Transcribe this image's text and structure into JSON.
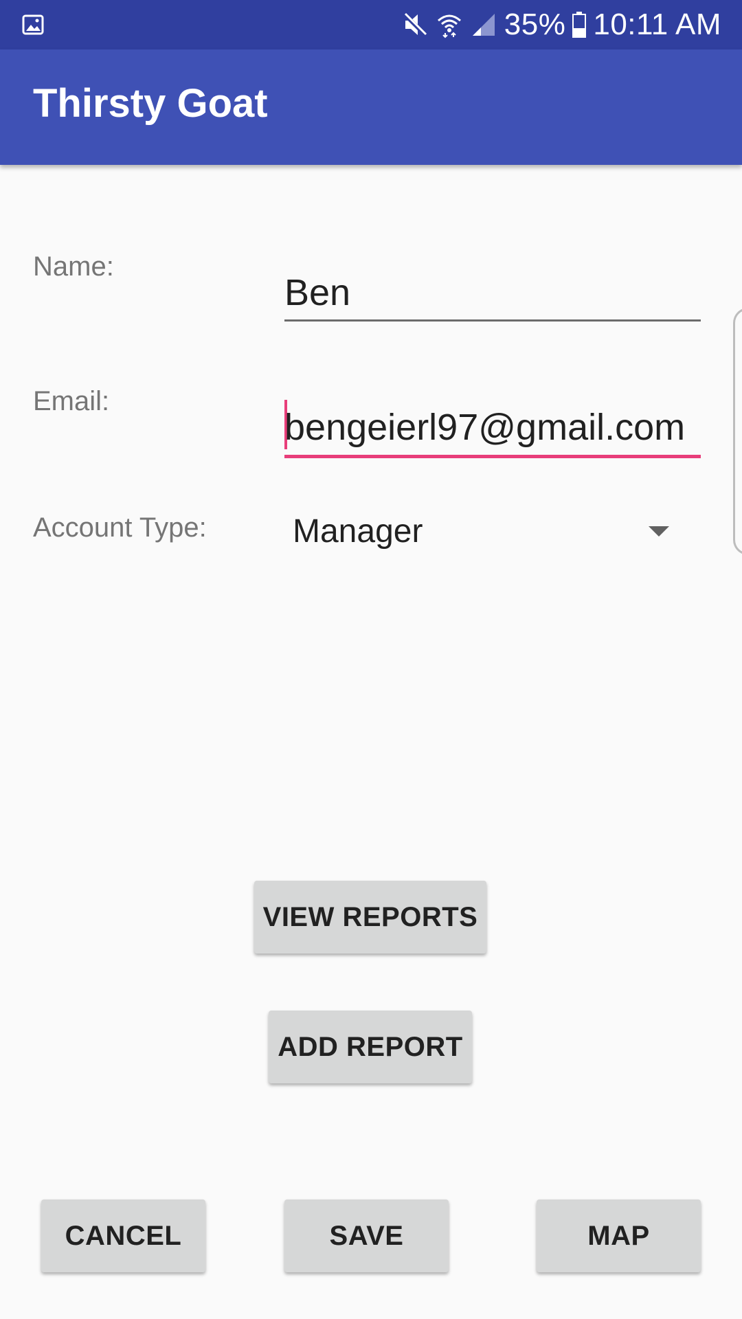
{
  "status_bar": {
    "battery": "35%",
    "time": "10:11 AM",
    "icons": [
      "image-icon",
      "mute-icon",
      "wifi-icon",
      "signal-icon",
      "battery-icon"
    ]
  },
  "app_bar": {
    "title": "Thirsty Goat"
  },
  "form": {
    "name_label": "Name:",
    "name_value": "Ben",
    "email_label": "Email:",
    "email_value": "bengeierl97@gmail.com",
    "account_type_label": "Account Type:",
    "account_type_value": "Manager"
  },
  "buttons": {
    "view_reports": "VIEW REPORTS",
    "add_report": "ADD REPORT",
    "cancel": "CANCEL",
    "save": "SAVE",
    "map": "MAP"
  },
  "colors": {
    "status_bar": "#303f9f",
    "app_bar": "#3f51b5",
    "accent": "#e83e7a",
    "button": "#d6d7d7"
  }
}
